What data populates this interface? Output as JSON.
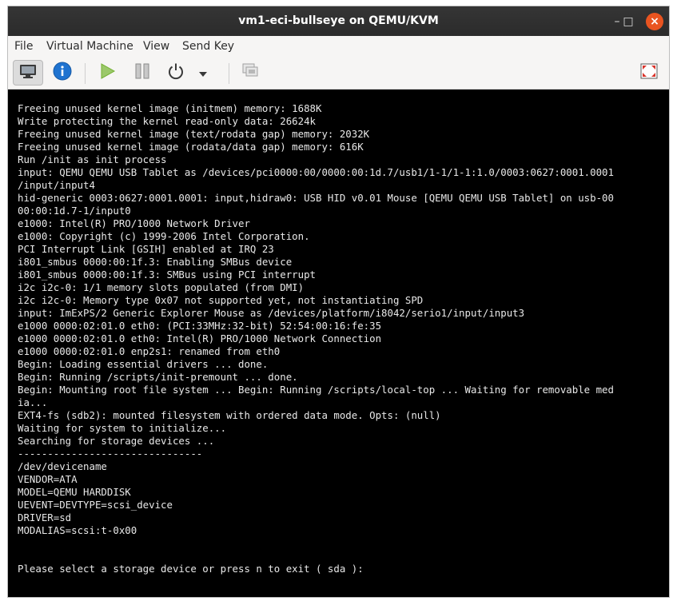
{
  "window": {
    "title": "vm1-eci-bullseye on QEMU/KVM",
    "controls": {
      "minimize": "–",
      "maximize": "□",
      "close": "×"
    }
  },
  "menu": [
    "File",
    "Virtual Machine",
    "View",
    "Send Key"
  ],
  "toolbar": {
    "items": [
      {
        "name": "show-console",
        "icon": "monitor-icon",
        "active": true
      },
      {
        "name": "details",
        "icon": "info-icon"
      },
      {
        "name": "run",
        "icon": "play-icon"
      },
      {
        "name": "pause",
        "icon": "pause-icon"
      },
      {
        "name": "shutdown",
        "icon": "power-icon"
      },
      {
        "name": "shutdown-menu",
        "icon": "dropdown-arrow-icon"
      },
      {
        "name": "snapshots",
        "icon": "snapshots-icon"
      },
      {
        "name": "fullscreen",
        "icon": "fullscreen-icon"
      }
    ]
  },
  "colors": {
    "accent_close": "#e95420",
    "info_blue": "#1f73d0",
    "play_green": "#73b032",
    "console_bg": "#000000"
  },
  "console": {
    "lines": [
      "Freeing unused kernel image (initmem) memory: 1688K",
      "Write protecting the kernel read-only data: 26624k",
      "Freeing unused kernel image (text/rodata gap) memory: 2032K",
      "Freeing unused kernel image (rodata/data gap) memory: 616K",
      "Run /init as init process",
      "input: QEMU QEMU USB Tablet as /devices/pci0000:00/0000:00:1d.7/usb1/1-1/1-1:1.0/0003:0627:0001.0001",
      "/input/input4",
      "hid-generic 0003:0627:0001.0001: input,hidraw0: USB HID v0.01 Mouse [QEMU QEMU USB Tablet] on usb-00",
      "00:00:1d.7-1/input0",
      "e1000: Intel(R) PRO/1000 Network Driver",
      "e1000: Copyright (c) 1999-2006 Intel Corporation.",
      "PCI Interrupt Link [GSIH] enabled at IRQ 23",
      "i801_smbus 0000:00:1f.3: Enabling SMBus device",
      "i801_smbus 0000:00:1f.3: SMBus using PCI interrupt",
      "i2c i2c-0: 1/1 memory slots populated (from DMI)",
      "i2c i2c-0: Memory type 0x07 not supported yet, not instantiating SPD",
      "input: ImExPS/2 Generic Explorer Mouse as /devices/platform/i8042/serio1/input/input3",
      "e1000 0000:02:01.0 eth0: (PCI:33MHz:32-bit) 52:54:00:16:fe:35",
      "e1000 0000:02:01.0 eth0: Intel(R) PRO/1000 Network Connection",
      "e1000 0000:02:01.0 enp2s1: renamed from eth0",
      "Begin: Loading essential drivers ... done.",
      "Begin: Running /scripts/init-premount ... done.",
      "Begin: Mounting root file system ... Begin: Running /scripts/local-top ... Waiting for removable med",
      "ia...",
      "EXT4-fs (sdb2): mounted filesystem with ordered data mode. Opts: (null)",
      "Waiting for system to initialize...",
      "Searching for storage devices ...",
      "-------------------------------",
      "/dev/devicename",
      "VENDOR=ATA",
      "MODEL=QEMU HARDDISK",
      "UEVENT=DEVTYPE=scsi_device",
      "DRIVER=sd",
      "MODALIAS=scsi:t-0x00",
      "",
      "",
      "Please select a storage device or press n to exit ( sda ):"
    ]
  }
}
